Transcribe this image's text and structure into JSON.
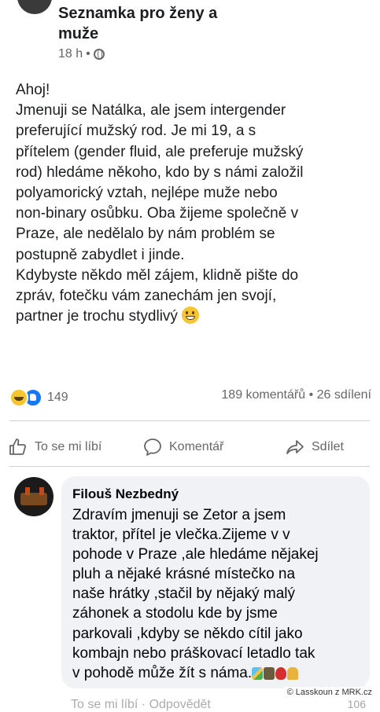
{
  "post": {
    "group_name_line1": "Seznamka pro ženy a",
    "group_name_line2": "muže",
    "time": "18 h",
    "separator": "•",
    "body_lines": [
      "Ahoj!",
      "Jmenuji se Natálka, ale jsem intergender",
      "preferující mužský rod. Je mi 19, a s",
      "přítelem (gender fluid, ale preferuje mužský",
      "rod) hledáme někoho, kdo by s námi založil",
      "polyamorický vztah, nejlépe muže nebo",
      "non-binary osůbku. Oba žijeme společně v",
      "Praze, ale nedělalo by nám problém se",
      "postupně zabydlet i jinde.",
      "Kdybyste někdo měl zájem, klidně pište do",
      "zpráv, fotečku vám zanechám jen svojí,",
      "partner je trochu stydlivý"
    ]
  },
  "stats": {
    "reaction_count": "149",
    "comments_shares": "189 komentářů • 26 sdílení"
  },
  "actions": {
    "like": "To se mi líbí",
    "comment": "Komentář",
    "share": "Sdílet"
  },
  "comment": {
    "author": "Filouš Nezbedný",
    "lines": [
      "Zdravím jmenuji se Zetor a jsem",
      "traktor, přítel je vlečka.Zijeme v v",
      "pohode v Praze ,ale hledáme nějakej",
      "pluh a nějaké krásné místečko na",
      "naše hrátky ,stačil by nějaký malý",
      "záhonek a stodolu kde by jsme",
      "parkovali ,kdyby se někdo cítil jako",
      "kombajn nebo práškovací letadlo tak",
      "v pohodě může žít s náma."
    ],
    "footer": "To se mi líbí · Odpovědět",
    "reaction_count": "106"
  },
  "watermark": "© Lasskoun z MRK.cz",
  "colors": {
    "secondary_text": "#65676b",
    "like_blue": "#1877f2",
    "bubble_bg": "#f0f2f5"
  },
  "icons": [
    "globe-icon",
    "grin-emoji",
    "haha-reaction",
    "like-reaction",
    "thumbs-up-icon",
    "comment-icon",
    "share-icon"
  ]
}
